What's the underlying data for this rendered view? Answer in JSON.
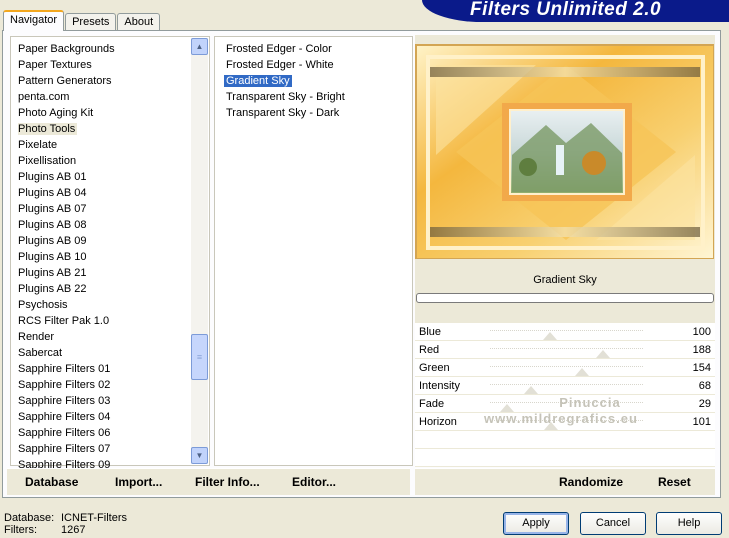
{
  "app": {
    "title": "Filters Unlimited 2.0"
  },
  "tabs": [
    {
      "label": "Navigator",
      "active": true
    },
    {
      "label": "Presets",
      "active": false
    },
    {
      "label": "About",
      "active": false
    }
  ],
  "categories": {
    "selected": "Photo Tools",
    "items": [
      "Paper Backgrounds",
      "Paper Textures",
      "Pattern Generators",
      "penta.com",
      "Photo Aging Kit",
      "Photo Tools",
      "Pixelate",
      "Pixellisation",
      "Plugins AB 01",
      "Plugins AB 04",
      "Plugins AB 07",
      "Plugins AB 08",
      "Plugins AB 09",
      "Plugins AB 10",
      "Plugins AB 21",
      "Plugins AB 22",
      "Psychosis",
      "RCS Filter Pak 1.0",
      "Render",
      "Sabercat",
      "Sapphire Filters 01",
      "Sapphire Filters 02",
      "Sapphire Filters 03",
      "Sapphire Filters 04",
      "Sapphire Filters 06",
      "Sapphire Filters 07",
      "Sapphire Filters 09"
    ]
  },
  "filters": {
    "selected": "Gradient Sky",
    "items": [
      "Frosted Edger - Color",
      "Frosted Edger - White",
      "Gradient Sky",
      "Transparent Sky - Bright",
      "Transparent Sky - Dark"
    ]
  },
  "current_filter": "Gradient Sky",
  "sliders": [
    {
      "name": "Blue",
      "value": "100"
    },
    {
      "name": "Red",
      "value": "188"
    },
    {
      "name": "Green",
      "value": "154"
    },
    {
      "name": "Intensity",
      "value": "68"
    },
    {
      "name": "Fade",
      "value": "29"
    },
    {
      "name": "Horizon",
      "value": "101"
    }
  ],
  "watermark": {
    "line1": "Pinuccia",
    "line2": "www.mildregrafics.eu"
  },
  "bottom_left_buttons": {
    "database": "Database",
    "import": "Import...",
    "filter_info": "Filter Info...",
    "editor": "Editor..."
  },
  "bottom_right_buttons": {
    "randomize": "Randomize",
    "reset": "Reset"
  },
  "status": {
    "database_label": "Database:",
    "database_value": "ICNET-Filters",
    "filters_label": "Filters:",
    "filters_value": "1267"
  },
  "dialog_buttons": {
    "apply": "Apply",
    "cancel": "Cancel",
    "help": "Help"
  },
  "colors": {
    "banner": "#0a1a8a",
    "selection": "#316ac5",
    "preview_gold": "#f2b63a"
  }
}
